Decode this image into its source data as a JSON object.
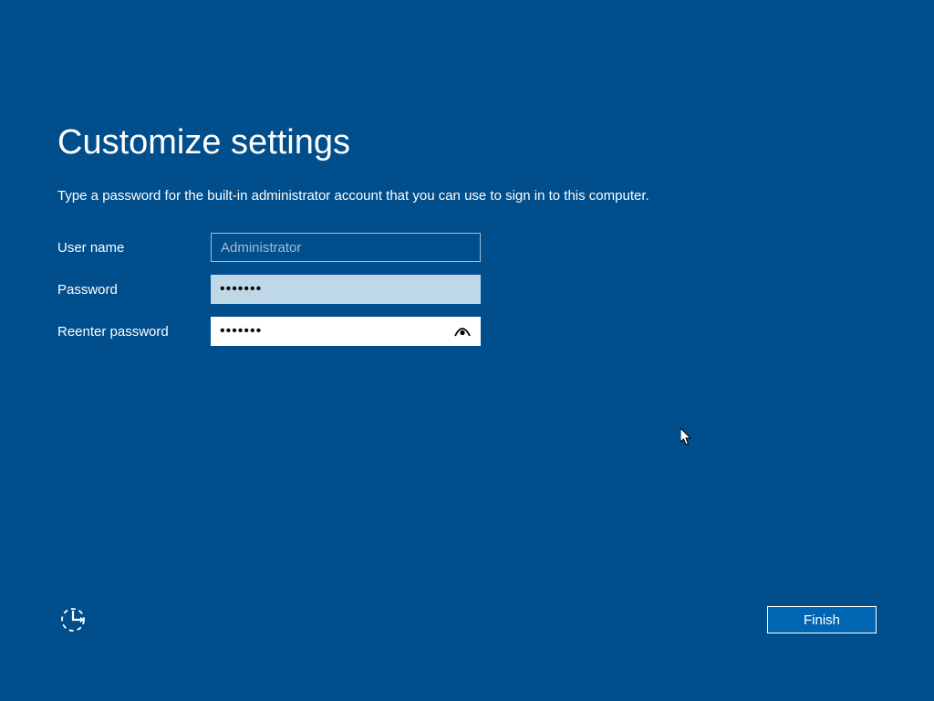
{
  "title": "Customize settings",
  "subtitle": "Type a password for the built-in administrator account that you can use to sign in to this computer.",
  "form": {
    "username_label": "User name",
    "username_value": "Administrator",
    "password_label": "Password",
    "password_masked": "•••••••",
    "reenter_label": "Reenter password",
    "reenter_masked": "•••••••"
  },
  "footer": {
    "finish_label": "Finish"
  }
}
